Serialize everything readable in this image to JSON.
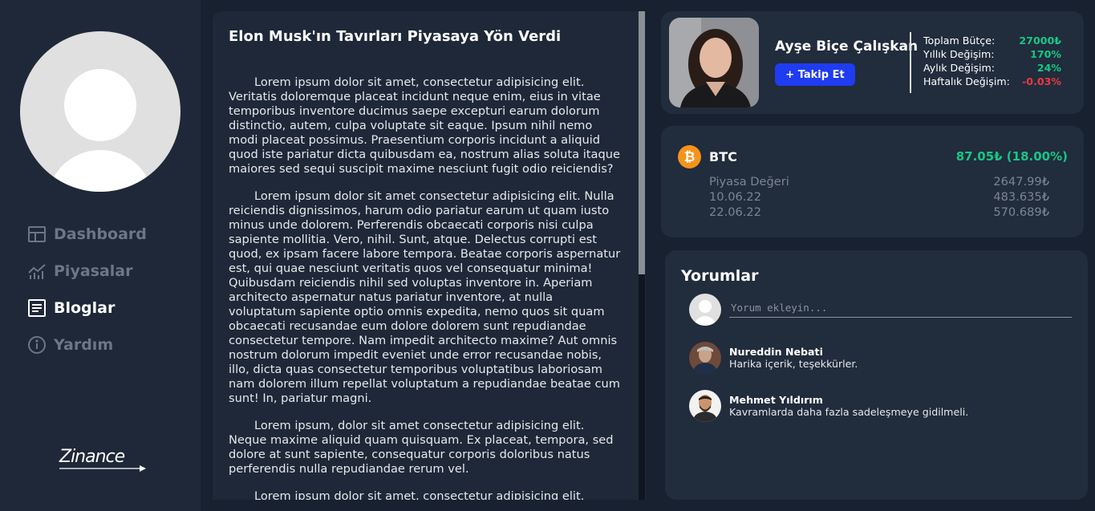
{
  "sidebar": {
    "nav": [
      {
        "label": "Dashboard",
        "icon": "dashboard-icon",
        "active": false
      },
      {
        "label": "Piyasalar",
        "icon": "chart-icon",
        "active": false
      },
      {
        "label": "Bloglar",
        "icon": "document-icon",
        "active": true
      },
      {
        "label": "Yardım",
        "icon": "info-icon",
        "active": false
      }
    ],
    "logo": "Zinance"
  },
  "article": {
    "title": "Elon Musk'ın Tavırları Piyasaya Yön Verdi",
    "paragraphs": [
      "Lorem ipsum dolor sit amet, consectetur adipisicing elit. Veritatis doloremque placeat incidunt neque enim, eius in vitae temporibus inventore ducimus saepe excepturi earum dolorum distinctio, autem, culpa voluptate sit eaque. Ipsum nihil nemo modi placeat possimus. Praesentium corporis incidunt a aliquid quod iste pariatur dicta quibusdam ea, nostrum alias soluta itaque maiores sed sequi suscipit maxime nesciunt fugit odio reiciendis?",
      "Lorem ipsum dolor sit amet consectetur adipisicing elit. Nulla reiciendis dignissimos, harum odio pariatur earum ut quam iusto minus unde dolorem. Perferendis obcaecati corporis nisi culpa sapiente mollitia. Vero, nihil. Sunt, atque. Delectus corrupti est quod, ex ipsam facere labore tempora. Beatae corporis aspernatur est, qui quae nesciunt veritatis quos vel consequatur minima! Quibusdam reiciendis nihil sed voluptas inventore in. Aperiam architecto aspernatur natus pariatur inventore, at nulla voluptatum sapiente optio omnis expedita, nemo quos sit quam obcaecati recusandae eum dolore dolorem sunt repudiandae consectetur tempore. Nam impedit architecto maxime? Aut omnis nostrum dolorum impedit eveniet unde error recusandae nobis, illo, dicta quas consectetur temporibus voluptatibus laboriosam nam dolorem illum repellat voluptatum a repudiandae beatae cum sunt! In, pariatur magni.",
      "Lorem ipsum, dolor sit amet consectetur adipisicing elit. Neque maxime aliquid quam quisquam. Ex placeat, tempora, sed dolore at sunt sapiente, consequatur corporis doloribus natus perferendis nulla repudiandae rerum vel.",
      "Lorem ipsum dolor sit amet, consectetur adipisicing elit."
    ]
  },
  "profile": {
    "name": "Ayşe Biçe Çalışkan",
    "follow_label": "+ Takip Et",
    "stats": [
      {
        "label": "Toplam Bütçe:",
        "value": "27000₺",
        "color": "#16c784"
      },
      {
        "label": "Yıllık Değişim:",
        "value": "170%",
        "color": "#16c784"
      },
      {
        "label": "Aylık Değişim:",
        "value": "24%",
        "color": "#16c784"
      },
      {
        "label": "Haftalık Değişim:",
        "value": "-0.03%",
        "color": "#ea3943"
      }
    ]
  },
  "btc": {
    "symbol": "BTC",
    "icon_glyph": "₿",
    "change": "87.05₺ (18.00%)",
    "rows": [
      {
        "label": "Piyasa Değeri",
        "value": "2647.99₺"
      },
      {
        "label": "10.06.22",
        "value": "483.635₺"
      },
      {
        "label": "22.06.22",
        "value": "570.689₺"
      }
    ]
  },
  "comments": {
    "title": "Yorumlar",
    "placeholder": "Yorum ekleyin...",
    "items": [
      {
        "name": "Nureddin Nebati",
        "text": "Harika içerik, teşekkürler."
      },
      {
        "name": "Mehmet Yıldırım",
        "text": "Kavramlarda daha fazla sadeleşmeye gidilmeli."
      }
    ]
  }
}
